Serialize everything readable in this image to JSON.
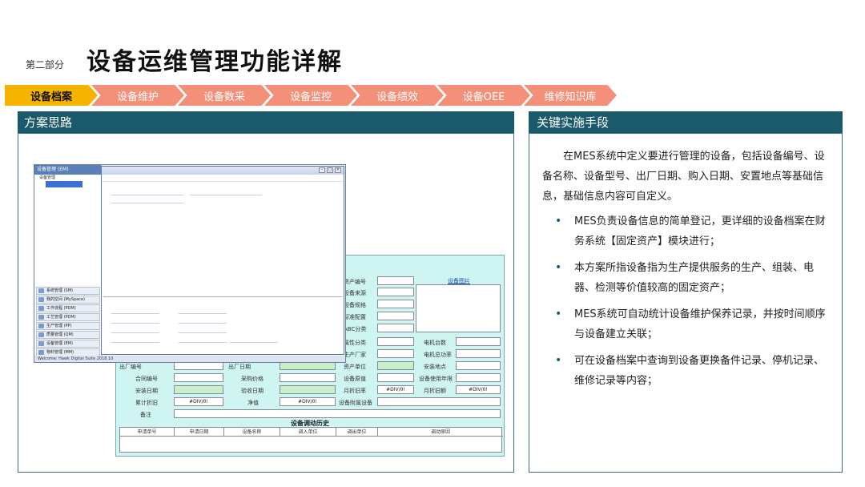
{
  "header": {
    "section_label": "第二部分",
    "title": "设备运维管理功能详解"
  },
  "tabs": [
    {
      "label": "设备档案",
      "active": true
    },
    {
      "label": "设备维护",
      "active": false
    },
    {
      "label": "设备数采",
      "active": false
    },
    {
      "label": "设备监控",
      "active": false
    },
    {
      "label": "设备绩效",
      "active": false
    },
    {
      "label": "设备OEE",
      "active": false
    },
    {
      "label": "维修知识库",
      "active": false
    }
  ],
  "left_panel": {
    "title": "方案思路",
    "screenshot": {
      "nav_title": "设备管理 (EM)",
      "tree_root": "设备管理",
      "nav_buttons": [
        "系统管理 (SM)",
        "我的空间 (MySpace)",
        "工作流程 (PDM)",
        "工艺管理 (PDM)",
        "生产管理 (PP)",
        "质量管理 (QM)",
        "设备管理 (EM)",
        "物料管理 (MM)"
      ],
      "status_text": "Welcome: Hawk Digital Suite 2018.10",
      "form_labels": {
        "asset_no": "资产编号",
        "source": "设备来源",
        "spec": "设备规格",
        "config": "标准配置",
        "abc": "ABC分类",
        "attribute": "属性分类",
        "maker": "生产厂家",
        "owner": "资产单位",
        "motor_count": "电机台数",
        "motor_power": "电机总功率",
        "install_place": "安装地点",
        "equip_no": "出厂编号",
        "factory_date": "出厂日期",
        "contract_no": "合同编号",
        "purchase_price": "采购价格",
        "original_value": "设备原值",
        "service_life": "设备使用年限",
        "install_date": "安装日期",
        "acceptance_date": "验收日期",
        "monthly_dep": "月折旧率",
        "monthly_dep_amt": "月折旧额",
        "acc_dep": "累计折旧",
        "net_value": "净值",
        "attached": "设备附属设备",
        "remark": "备注"
      },
      "image_label": "设备图片",
      "error_value": "#DIV/0!",
      "history_title": "设备调动历史",
      "history_cols": [
        "申请单号",
        "申请日期",
        "设备名称",
        "调入单位",
        "调出单位",
        "调动原因"
      ]
    }
  },
  "right_panel": {
    "title": "关键实施手段",
    "intro": "在MES系统中定义要进行管理的设备，包括设备编号、设备名称、设备型号、出厂日期、购入日期、安置地点等基础信息，基础信息内容可自定义。",
    "bullets": [
      "MES负责设备信息的简单登记，更详细的设备档案在财务系统【固定资产】模块进行；",
      "本方案所指设备指为生产提供服务的生产、组装、电器、检测等价值较高的固定资产；",
      "MES系统可自动统计设备维护保养记录，并按时间顺序与设备建立关联；",
      "可在设备档案中查询到设备更换备件记录、停机记录、维修记录等内容；"
    ]
  },
  "colors": {
    "header_bar": "#1a5a6b",
    "tab_active": "#f6b400",
    "tab_normal": "#f4907a",
    "form_bg": "#cff5f3"
  }
}
